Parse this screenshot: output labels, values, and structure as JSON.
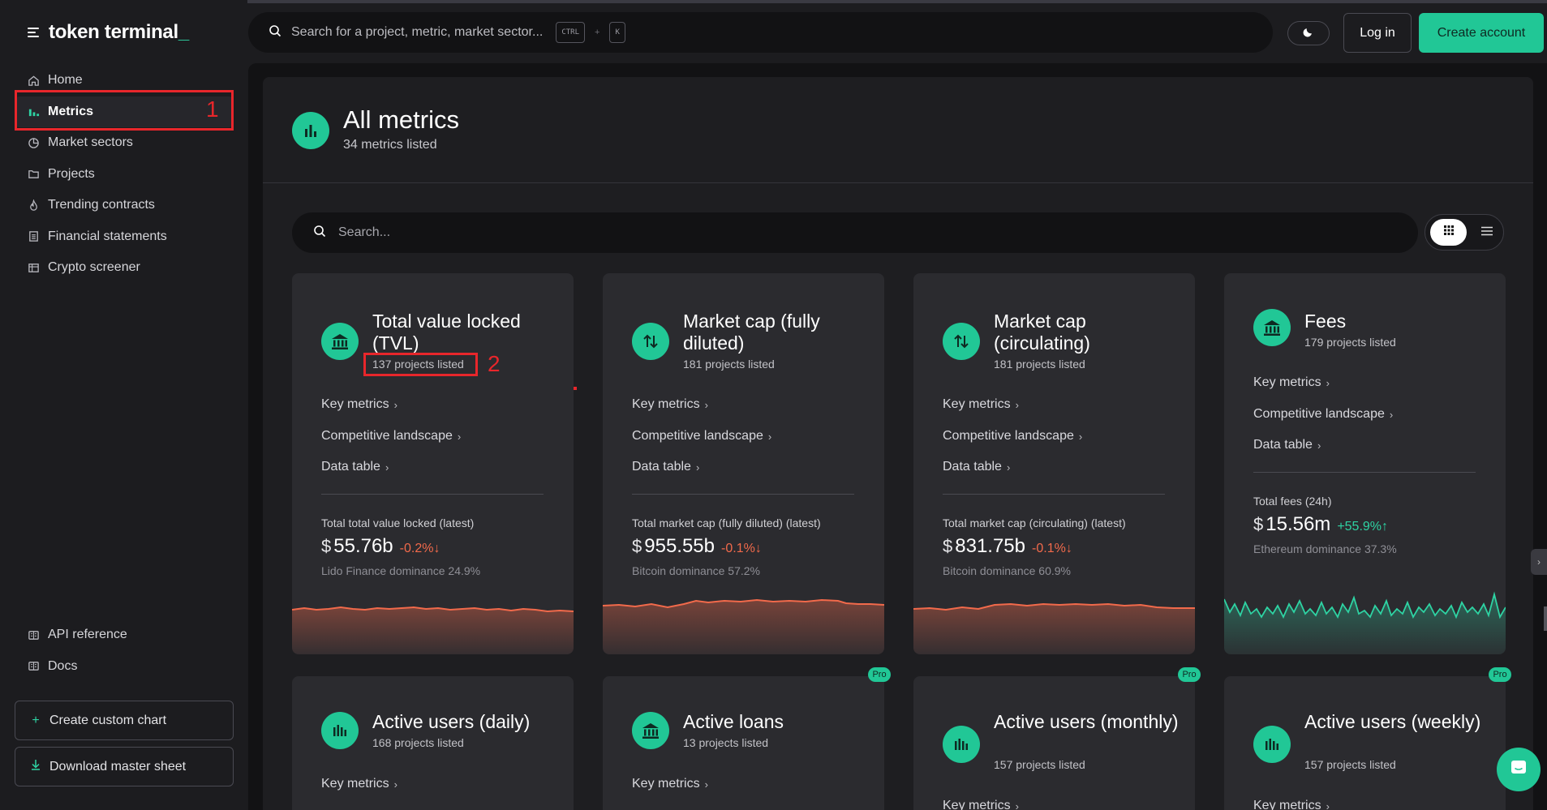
{
  "brand": {
    "name": "token terminal",
    "underscore": "_"
  },
  "sidebar": {
    "items": [
      {
        "label": "Home",
        "icon": "home-icon"
      },
      {
        "label": "Metrics",
        "icon": "bar-chart-icon",
        "active": true
      },
      {
        "label": "Market sectors",
        "icon": "pie-chart-icon"
      },
      {
        "label": "Projects",
        "icon": "folder-icon"
      },
      {
        "label": "Trending contracts",
        "icon": "flame-icon"
      },
      {
        "label": "Financial statements",
        "icon": "document-icon"
      },
      {
        "label": "Crypto screener",
        "icon": "table-icon"
      }
    ],
    "bottom_items": [
      {
        "label": "API reference",
        "icon": "book-icon"
      },
      {
        "label": "Docs",
        "icon": "book-open-icon"
      }
    ],
    "create_chart_label": "Create custom chart",
    "download_label": "Download master sheet"
  },
  "topbar": {
    "search_placeholder": "Search for a project, metric, market sector...",
    "kbd_ctrl": "CTRL",
    "kbd_plus": "+",
    "kbd_k": "K",
    "login_label": "Log in",
    "create_account_label": "Create account"
  },
  "annotations": {
    "one": "1",
    "two": "2"
  },
  "page": {
    "title": "All metrics",
    "subtitle": "34 metrics listed",
    "search_placeholder": "Search..."
  },
  "colors": {
    "accent": "#21c796",
    "negative": "#f26a4b",
    "positive": "#2ed3a3",
    "background": "#1c1c1f"
  },
  "cards": [
    {
      "title": "Total value locked (TVL)",
      "subtitle": "137 projects listed",
      "icon": "bank-icon",
      "links": [
        "Key metrics",
        "Competitive landscape",
        "Data table"
      ],
      "stat_label": "Total total value locked (latest)",
      "currency": "$",
      "stat_value": "55.76b",
      "stat_change": "-0.2%↓",
      "dominance": "Lido Finance dominance 24.9%",
      "trend": "negative"
    },
    {
      "title": "Market cap (fully diluted)",
      "subtitle": "181 projects listed",
      "icon": "arrows-up-down-icon",
      "links": [
        "Key metrics",
        "Competitive landscape",
        "Data table"
      ],
      "stat_label": "Total market cap (fully diluted) (latest)",
      "currency": "$",
      "stat_value": "955.55b",
      "stat_change": "-0.1%↓",
      "dominance": "Bitcoin dominance 57.2%",
      "trend": "negative"
    },
    {
      "title": "Market cap (circulating)",
      "subtitle": "181 projects listed",
      "icon": "arrows-up-down-icon",
      "links": [
        "Key metrics",
        "Competitive landscape",
        "Data table"
      ],
      "stat_label": "Total market cap (circulating) (latest)",
      "currency": "$",
      "stat_value": "831.75b",
      "stat_change": "-0.1%↓",
      "dominance": "Bitcoin dominance 60.9%",
      "trend": "negative"
    },
    {
      "title": "Fees",
      "subtitle": "179 projects listed",
      "icon": "bank-icon",
      "links": [
        "Key metrics",
        "Competitive landscape",
        "Data table"
      ],
      "stat_label": "Total fees (24h)",
      "currency": "$",
      "stat_value": "15.56m",
      "stat_change": "+55.9%↑",
      "dominance": "Ethereum dominance 37.3%",
      "trend": "positive"
    },
    {
      "title": "Active users (daily)",
      "subtitle": "168 projects listed",
      "icon": "bars-icon",
      "link": "Key metrics",
      "pro": ""
    },
    {
      "title": "Active loans",
      "subtitle": "13 projects listed",
      "icon": "bank-icon",
      "link": "Key metrics",
      "pro": "Pro"
    },
    {
      "title": "Active users (monthly)",
      "subtitle": "157 projects listed",
      "icon": "bars-icon",
      "link": "Key metrics",
      "pro": "Pro"
    },
    {
      "title": "Active users (weekly)",
      "subtitle": "157 projects listed",
      "icon": "bars-icon",
      "link": "Key metrics",
      "pro": "Pro"
    }
  ]
}
